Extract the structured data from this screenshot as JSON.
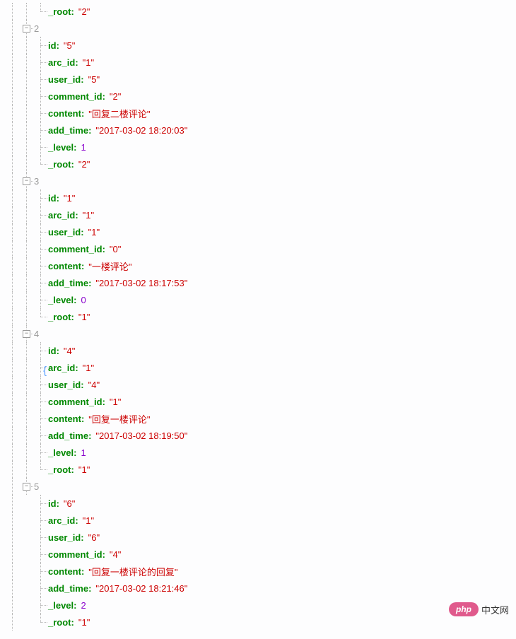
{
  "orphan": {
    "key": "_root",
    "value": "\"2\""
  },
  "nodes": [
    {
      "index": "2",
      "props": [
        {
          "key": "id",
          "value": "\"5\""
        },
        {
          "key": "arc_id",
          "value": "\"1\""
        },
        {
          "key": "user_id",
          "value": "\"5\""
        },
        {
          "key": "comment_id",
          "value": "\"2\""
        },
        {
          "key": "content",
          "value": "\"回复二楼评论\""
        },
        {
          "key": "add_time",
          "value": "\"2017-03-02 18:20:03\""
        },
        {
          "key": "_level",
          "value": "1",
          "numeric": true
        },
        {
          "key": "_root",
          "value": "\"2\""
        }
      ]
    },
    {
      "index": "3",
      "props": [
        {
          "key": "id",
          "value": "\"1\""
        },
        {
          "key": "arc_id",
          "value": "\"1\""
        },
        {
          "key": "user_id",
          "value": "\"1\""
        },
        {
          "key": "comment_id",
          "value": "\"0\""
        },
        {
          "key": "content",
          "value": "\"一楼评论\""
        },
        {
          "key": "add_time",
          "value": "\"2017-03-02 18:17:53\""
        },
        {
          "key": "_level",
          "value": "0",
          "numeric": true
        },
        {
          "key": "_root",
          "value": "\"1\""
        }
      ]
    },
    {
      "index": "4",
      "props": [
        {
          "key": "id",
          "value": "\"4\""
        },
        {
          "key": "arc_id",
          "value": "\"1\"",
          "highlight": true
        },
        {
          "key": "user_id",
          "value": "\"4\""
        },
        {
          "key": "comment_id",
          "value": "\"1\""
        },
        {
          "key": "content",
          "value": "\"回复一楼评论\""
        },
        {
          "key": "add_time",
          "value": "\"2017-03-02 18:19:50\""
        },
        {
          "key": "_level",
          "value": "1",
          "numeric": true
        },
        {
          "key": "_root",
          "value": "\"1\""
        }
      ]
    },
    {
      "index": "5",
      "last": true,
      "props": [
        {
          "key": "id",
          "value": "\"6\""
        },
        {
          "key": "arc_id",
          "value": "\"1\""
        },
        {
          "key": "user_id",
          "value": "\"6\""
        },
        {
          "key": "comment_id",
          "value": "\"4\""
        },
        {
          "key": "content",
          "value": "\"回复一楼评论的回复\""
        },
        {
          "key": "add_time",
          "value": "\"2017-03-02 18:21:46\""
        },
        {
          "key": "_level",
          "value": "2",
          "numeric": true
        },
        {
          "key": "_root",
          "value": "\"1\""
        }
      ]
    }
  ],
  "watermark": {
    "badge": "php",
    "text": "中文网"
  },
  "toggle_glyph": "−"
}
